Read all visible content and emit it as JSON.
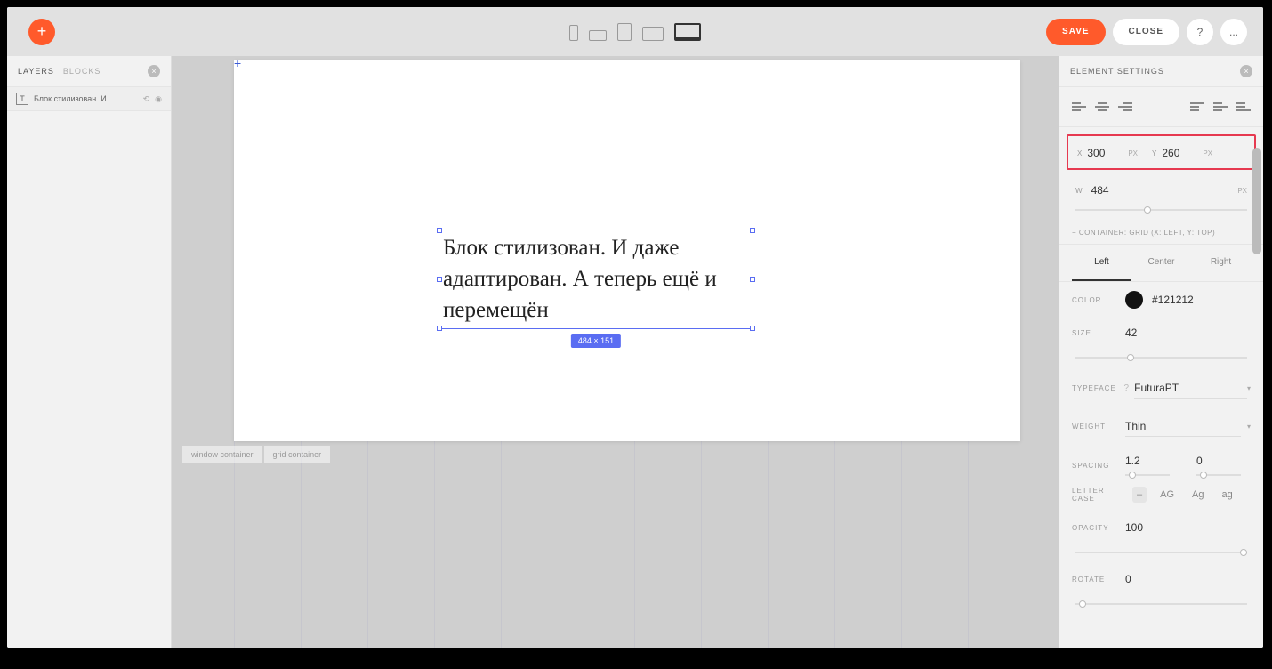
{
  "topbar": {
    "save_label": "SAVE",
    "close_label": "CLOSE",
    "help_label": "?",
    "more_label": "..."
  },
  "left_panel": {
    "tabs": {
      "layers": "LAYERS",
      "blocks": "BLOCKS"
    },
    "layer_name": "Блок стилизован. И..."
  },
  "canvas": {
    "text_content": "Блок стилизован. И даже адаптирован. А теперь ещё и перемещён",
    "dim_badge": "484 × 151",
    "container_tabs": {
      "window": "window container",
      "grid": "grid container"
    }
  },
  "right_panel": {
    "title": "ELEMENT SETTINGS",
    "pos": {
      "x_label": "X",
      "x_val": "300",
      "y_label": "Y",
      "y_val": "260",
      "unit": "PX"
    },
    "width": {
      "label": "W",
      "val": "484",
      "unit": "PX"
    },
    "container_note": "− CONTAINER: GRID (X: LEFT, Y: TOP)",
    "text_align": {
      "left": "Left",
      "center": "Center",
      "right": "Right"
    },
    "color": {
      "label": "COLOR",
      "hex": "#121212"
    },
    "size": {
      "label": "SIZE",
      "val": "42"
    },
    "typeface": {
      "label": "TYPEFACE",
      "val": "FuturaPT"
    },
    "weight": {
      "label": "WEIGHT",
      "val": "Thin"
    },
    "spacing": {
      "label": "SPACING",
      "v1": "1.2",
      "v2": "0"
    },
    "lettercase": {
      "label": "LETTER CASE",
      "opts": [
        "–",
        "AG",
        "Ag",
        "ag"
      ]
    },
    "opacity": {
      "label": "OPACITY",
      "val": "100"
    },
    "rotate": {
      "label": "ROTATE",
      "val": "0"
    }
  }
}
